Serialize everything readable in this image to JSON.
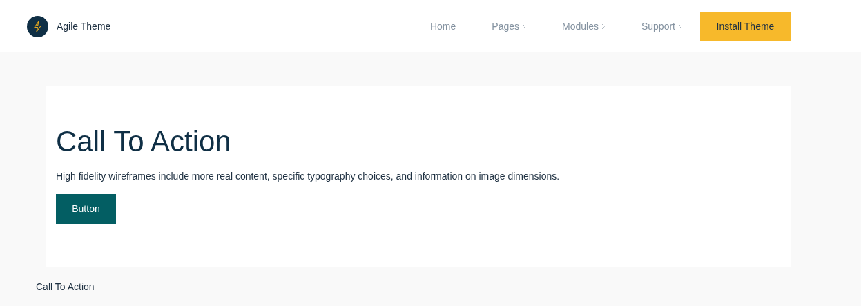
{
  "header": {
    "brand": "Agile Theme",
    "nav": [
      {
        "label": "Home",
        "has_submenu": false
      },
      {
        "label": "Pages",
        "has_submenu": true
      },
      {
        "label": "Modules",
        "has_submenu": true
      },
      {
        "label": "Support",
        "has_submenu": true
      }
    ],
    "cta": "Install Theme"
  },
  "card": {
    "title": "Call To Action",
    "text": "High fidelity wireframes include more real content, specific typography choices, and information on image dimensions.",
    "button": "Button"
  },
  "caption": "Call To Action"
}
